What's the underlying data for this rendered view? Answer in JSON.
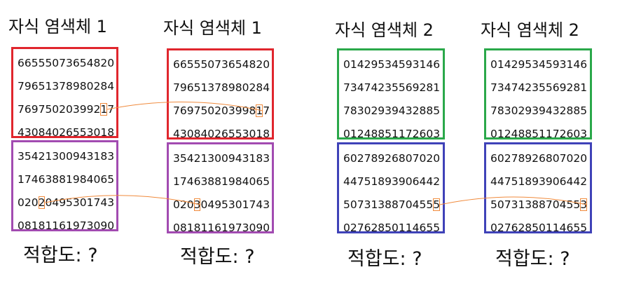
{
  "columns": [
    {
      "title": "자식 염색체 1",
      "fitness": "적합도: ?",
      "top_color": "#e0262d",
      "bottom_color": "#a24bb1",
      "top_rows": [
        "66555073654820",
        "79651378980284",
        "76975020399217",
        "43084026553018"
      ],
      "bottom_rows": [
        "35421300943183",
        "17463881984065",
        "02020495301743",
        "08181161973090"
      ]
    },
    {
      "title": "자식 염색체 1",
      "fitness": "적합도: ?",
      "top_color": "#e0262d",
      "bottom_color": "#a24bb1",
      "top_rows": [
        "66555073654820",
        "79651378980284",
        "76975020399817",
        "43084026553018"
      ],
      "bottom_rows": [
        "35421300943183",
        "17463881984065",
        "02030495301743",
        "08181161973090"
      ]
    },
    {
      "title": "자식 염색체 2",
      "fitness": "적합도: ?",
      "top_color": "#2aa84a",
      "bottom_color": "#3f42b8",
      "top_rows": [
        "01429534593146",
        "73474235569281",
        "78302939432885",
        "01248851172603"
      ],
      "bottom_rows": [
        "60278926807020",
        "44751893906442",
        "50731388704555",
        "02762850114655"
      ]
    },
    {
      "title": "자식 염색체 2",
      "fitness": "적합도: ?",
      "top_color": "#2aa84a",
      "bottom_color": "#3f42b8",
      "top_rows": [
        "01429534593146",
        "73474235569281",
        "78302939432885",
        "01248851172603"
      ],
      "bottom_rows": [
        "60278926807020",
        "44751893906442",
        "50731388704553",
        "02762850114655"
      ]
    }
  ],
  "highlight_color": "#f08a3c",
  "mutations": [
    {
      "from_column": 0,
      "to_column": 1,
      "block": "top",
      "row": 2,
      "digit_index": 12
    },
    {
      "from_column": 0,
      "to_column": 1,
      "block": "bottom",
      "row": 2,
      "digit_index": 3
    },
    {
      "from_column": 2,
      "to_column": 3,
      "block": "bottom",
      "row": 2,
      "digit_index": 13
    }
  ]
}
